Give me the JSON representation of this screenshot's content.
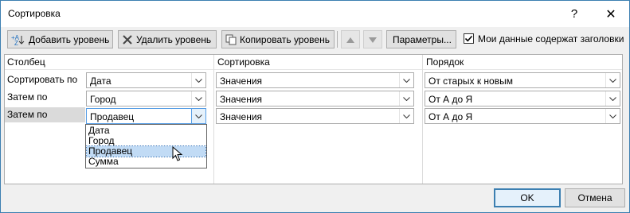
{
  "window": {
    "title": "Сортировка",
    "help_glyph": "?",
    "close_glyph": "✕"
  },
  "toolbar": {
    "add_level": "Добавить уровень",
    "delete_level": "Удалить уровень",
    "copy_level": "Копировать уровень",
    "options": "Параметры...",
    "headers_checkbox_label": "Мои данные содержат заголовки",
    "headers_checked": true
  },
  "columns": {
    "column": "Столбец",
    "sort_on": "Сортировка",
    "order": "Порядок"
  },
  "rows": [
    {
      "label": "Сортировать по",
      "column": "Дата",
      "sort_on": "Значения",
      "order": "От старых к новым"
    },
    {
      "label": "Затем по",
      "column": "Город",
      "sort_on": "Значения",
      "order": "От А до Я"
    },
    {
      "label": "Затем по",
      "column": "Продавец",
      "sort_on": "Значения",
      "order": "От А до Я",
      "selected": true
    }
  ],
  "dropdown": {
    "options": [
      "Дата",
      "Город",
      "Продавец",
      "Сумма"
    ],
    "highlighted": "Продавец"
  },
  "buttons": {
    "ok": "OK",
    "cancel": "Отмена"
  },
  "colors": {
    "accent": "#3c7fb1",
    "selection": "#c1dbf5",
    "row_highlight": "#dadada"
  }
}
